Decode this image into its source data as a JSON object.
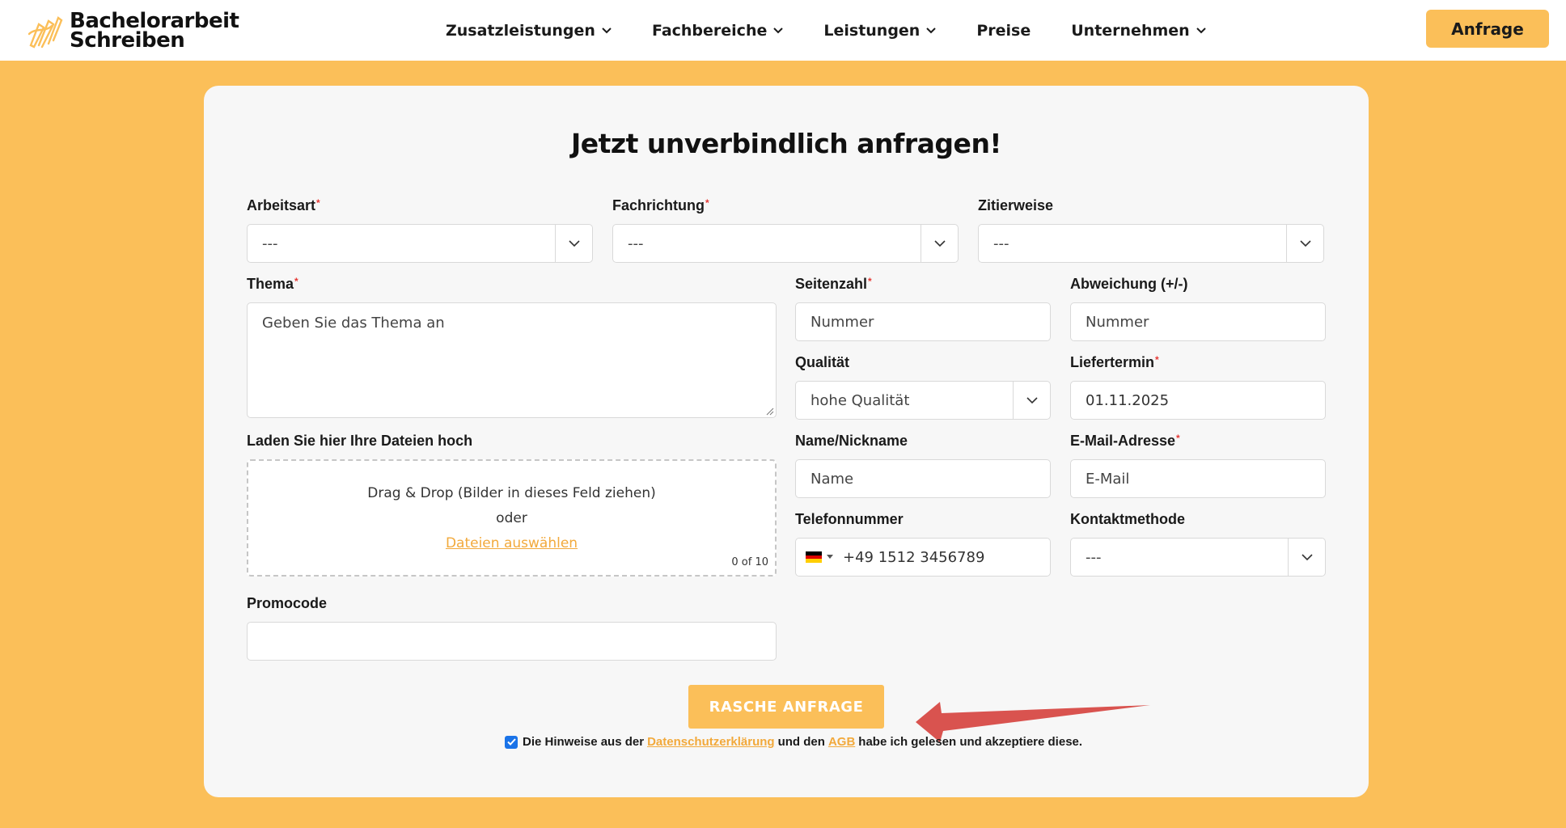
{
  "header": {
    "logo_line1": "Bachelorarbeit",
    "logo_line2": "Schreiben",
    "nav": [
      {
        "label": "Zusatzleistungen",
        "has_menu": true
      },
      {
        "label": "Fachbereiche",
        "has_menu": true
      },
      {
        "label": "Leistungen",
        "has_menu": true
      },
      {
        "label": "Preise",
        "has_menu": false
      },
      {
        "label": "Unternehmen",
        "has_menu": true
      }
    ],
    "cta_label": "Anfrage"
  },
  "form": {
    "title": "Jetzt unverbindlich anfragen!",
    "arbeitsart": {
      "label": "Arbeitsart",
      "value": "---"
    },
    "fachrichtung": {
      "label": "Fachrichtung",
      "value": "---"
    },
    "zitierweise": {
      "label": "Zitierweise",
      "value": "---"
    },
    "thema": {
      "label": "Thema",
      "placeholder": "Geben Sie das Thema an"
    },
    "seitenzahl": {
      "label": "Seitenzahl",
      "placeholder": "Nummer"
    },
    "abweichung": {
      "label": "Abweichung (+/-)",
      "placeholder": "Nummer"
    },
    "qualitaet": {
      "label": "Qualität",
      "value": "hohe Qualität"
    },
    "liefertermin": {
      "label": "Liefertermin",
      "value": "01.11.2025"
    },
    "upload": {
      "label": "Laden Sie hier Ihre Dateien hoch",
      "line1": "Drag & Drop (Bilder in dieses Feld ziehen)",
      "line2": "oder",
      "link": "Dateien auswählen",
      "count": "0 of 10"
    },
    "name": {
      "label": "Name/Nickname",
      "placeholder": "Name"
    },
    "email": {
      "label": "E-Mail-Adresse",
      "placeholder": "E-Mail"
    },
    "telefon": {
      "label": "Telefonnummer",
      "value": "+49 1512 3456789"
    },
    "kontaktmethode": {
      "label": "Kontaktmethode",
      "value": "---"
    },
    "promocode": {
      "label": "Promocode",
      "value": ""
    },
    "submit_label": "RASCHE ANFRAGE",
    "consent": {
      "checked": true,
      "text_before": "Die Hinweise aus der",
      "link1": "Datenschutzerklärung",
      "text_middle": "und den",
      "link2": "AGB",
      "text_after": "habe ich gelesen und akzeptiere diese."
    }
  },
  "colors": {
    "brand": "#fbbf59",
    "link": "#f2a93b",
    "required": "#e53935",
    "annotation_arrow": "#d9534f"
  },
  "icons": [
    "logo-pencil-icon",
    "chevron-down-icon",
    "germany-flag-icon",
    "checkbox-checked-icon",
    "annotation-arrow"
  ]
}
